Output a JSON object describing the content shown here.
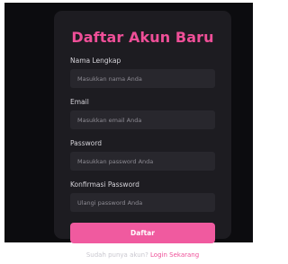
{
  "form": {
    "title": "Daftar Akun Baru",
    "fields": [
      {
        "label": "Nama Lengkap",
        "placeholder": "Masukkan nama Anda",
        "value": ""
      },
      {
        "label": "Email",
        "placeholder": "Masukkan email Anda",
        "value": ""
      },
      {
        "label": "Password",
        "placeholder": "Masukkan password Anda",
        "value": ""
      },
      {
        "label": "Konfirmasi Password",
        "placeholder": "Ulangi password Anda",
        "value": ""
      }
    ],
    "submit_label": "Daftar",
    "login_prompt": "Sudah punya akun?",
    "login_link": "Login Sekarang"
  },
  "colors": {
    "accent": "#ef4f98",
    "button": "#f05a9f",
    "background": "#0c0c0f",
    "card": "#1d1c21",
    "input": "#28272d"
  }
}
